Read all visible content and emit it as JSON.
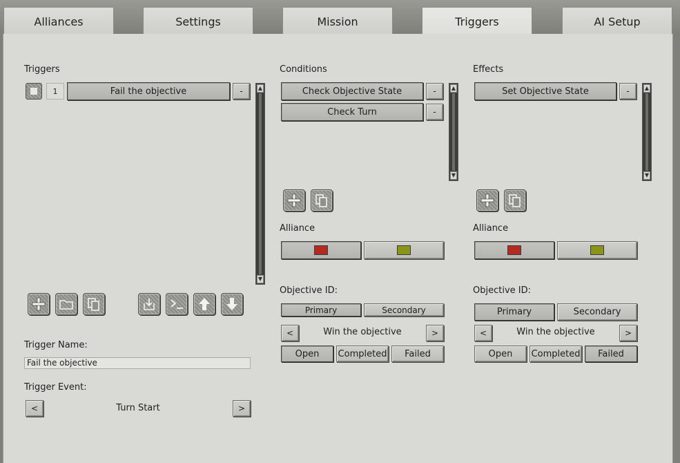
{
  "tabs": [
    {
      "label": "Alliances"
    },
    {
      "label": "Settings"
    },
    {
      "label": "Mission"
    },
    {
      "label": "Triggers",
      "active": true
    },
    {
      "label": "AI Setup"
    }
  ],
  "triggers": {
    "header": "Triggers",
    "items": [
      {
        "index": "1",
        "name": "Fail the objective",
        "remove": "-"
      }
    ],
    "toolbar_icons": [
      "plus-icon",
      "folder-icon",
      "copy-icon",
      "import-icon",
      "console-icon",
      "arrow-up-icon",
      "arrow-down-icon"
    ],
    "name_label": "Trigger Name:",
    "name_value": "Fail the objective",
    "event_label": "Trigger Event:",
    "event_prev": "<",
    "event_value": "Turn Start",
    "event_next": ">"
  },
  "conditions": {
    "header": "Conditions",
    "items": [
      {
        "name": "Check Objective State",
        "remove": "-"
      },
      {
        "name": "Check Turn",
        "remove": "-"
      }
    ],
    "alliance_label": "Alliance",
    "alliance_colors": [
      "#b32a22",
      "#8a9419"
    ],
    "objective_label": "Objective ID:",
    "primary": "Primary",
    "secondary": "Secondary",
    "prev": "<",
    "objective_value": "Win the objective",
    "next": ">",
    "states": [
      "Open",
      "Completed",
      "Failed"
    ],
    "selected_state": "Open"
  },
  "effects": {
    "header": "Effects",
    "items": [
      {
        "name": "Set Objective State",
        "remove": "-"
      }
    ],
    "alliance_label": "Alliance",
    "alliance_colors": [
      "#b32a22",
      "#8a9419"
    ],
    "objective_label": "Objective ID:",
    "primary": "Primary",
    "secondary": "Secondary",
    "prev": "<",
    "objective_value": "Win the objective",
    "next": ">",
    "states": [
      "Open",
      "Completed",
      "Failed"
    ],
    "selected_state": "Failed"
  },
  "colors": {
    "panel": "#d9d9d6",
    "frame": "#7f7f7b",
    "alliance_red": "#b32a22",
    "alliance_olive": "#8a9419"
  }
}
